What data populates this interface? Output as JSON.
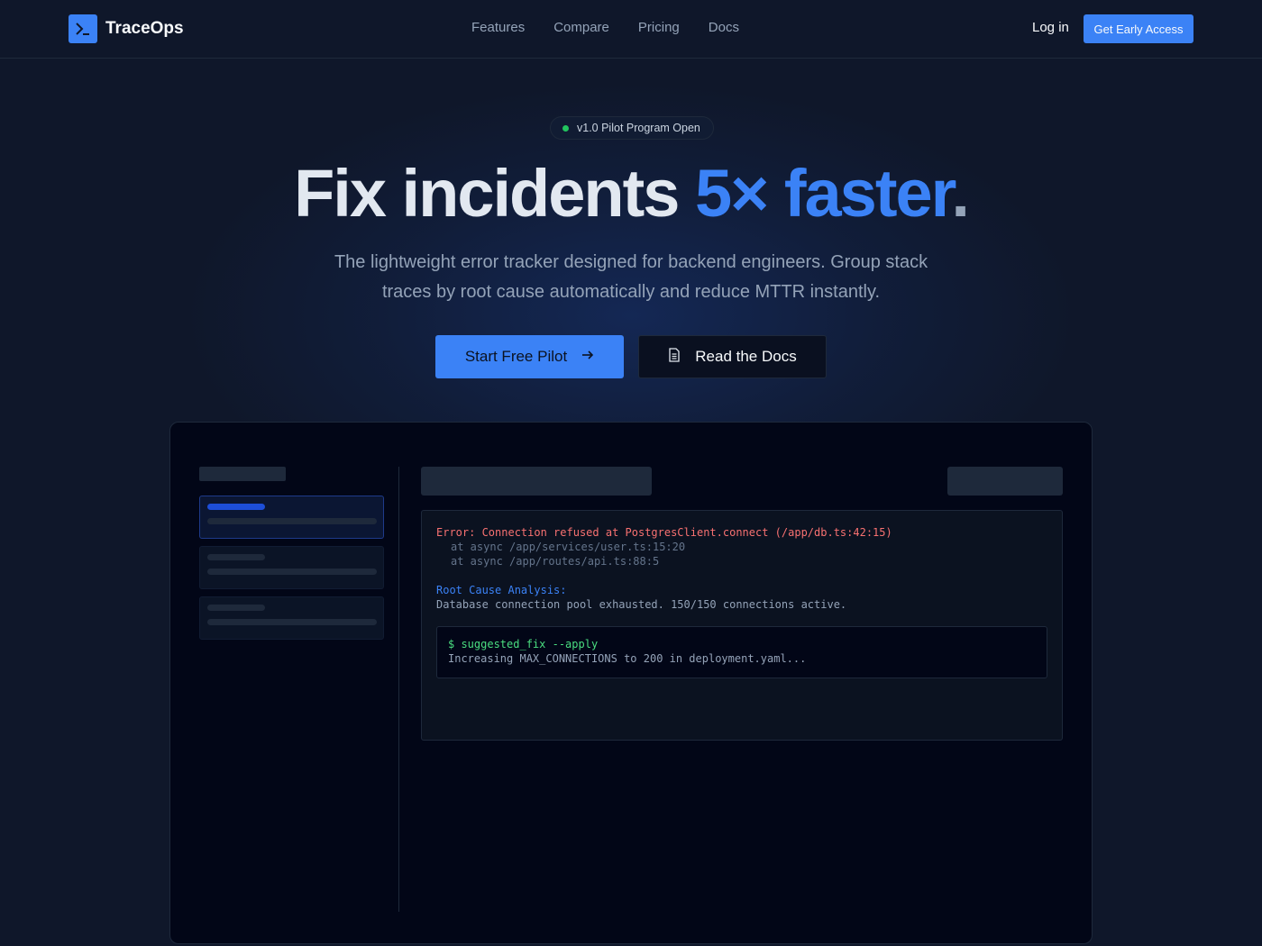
{
  "nav": {
    "brand": "TraceOps",
    "links": [
      "Features",
      "Compare",
      "Pricing",
      "Docs"
    ],
    "login": "Log in",
    "cta": "Get Early Access"
  },
  "hero": {
    "badge": "v1.0 Pilot Program Open",
    "headline_main": "Fix incidents ",
    "headline_accent": "5× faster",
    "headline_dot": ".",
    "subtitle": "The lightweight error tracker designed for backend engineers. Group stack traces by root cause automatically and reduce MTTR instantly.",
    "primary_button": "Start Free Pilot",
    "secondary_button": "Read the Docs"
  },
  "mockup": {
    "error_line": "Error: Connection refused at PostgresClient.connect (/app/db.ts:42:15)",
    "trace_lines": [
      "at async /app/services/user.ts:15:20",
      "at async /app/routes/api.ts:88:5"
    ],
    "rca_label": "Root Cause Analysis:",
    "rca_text": "Database connection pool exhausted. 150/150 connections active.",
    "terminal_command": "$ suggested_fix --apply",
    "terminal_output": "Increasing MAX_CONNECTIONS to 200 in deployment.yaml..."
  },
  "icons": {
    "logo": "terminal-icon",
    "primary_button": "arrow-right-icon",
    "secondary_button": "document-icon"
  },
  "colors": {
    "background": "#0f172a",
    "accent": "#3b82f6",
    "status_dot": "#22c55e",
    "error": "#f87171",
    "success": "#4ade80"
  }
}
